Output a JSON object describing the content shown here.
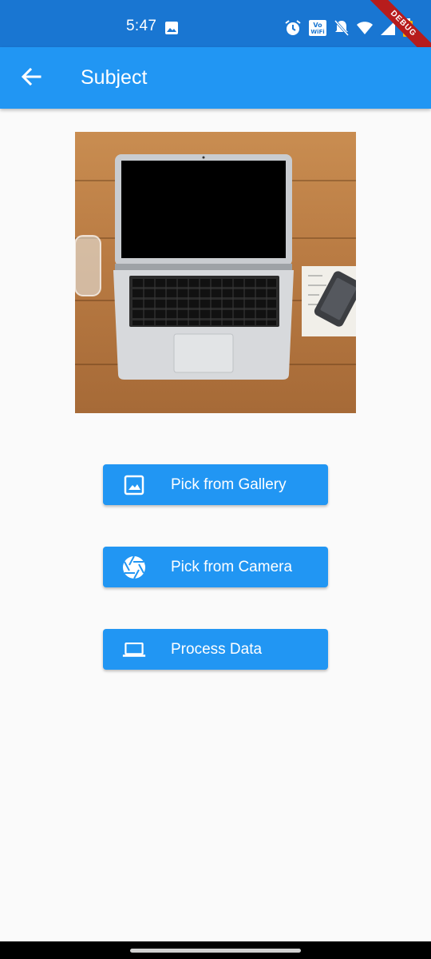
{
  "status_bar": {
    "time": "5:47",
    "wifi_badge": "Vo WiFi",
    "icons": [
      "gallery-icon",
      "alarm-icon",
      "vowifi-icon",
      "mute-icon",
      "wifi-icon",
      "signal-icon",
      "battery-icon"
    ]
  },
  "debug_banner": "DEBUG",
  "app_bar": {
    "title": "Subject",
    "back_icon": "arrow-back-icon"
  },
  "image": {
    "description_icon": "laptop-photo"
  },
  "buttons": [
    {
      "label": "Pick from Gallery",
      "icon": "image-icon"
    },
    {
      "label": "Pick from Camera",
      "icon": "camera-icon"
    },
    {
      "label": "Process Data",
      "icon": "laptop-icon"
    }
  ],
  "colors": {
    "status_bar": "#1976d2",
    "app_bar": "#2196f3",
    "button": "#2196f3",
    "background": "#fafafa",
    "debug": "#b71c1c"
  }
}
